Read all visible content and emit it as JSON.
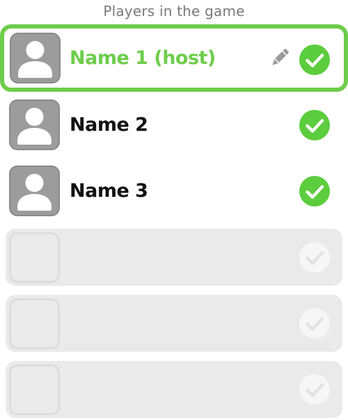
{
  "header": {
    "title": "Players in the game"
  },
  "players": [
    {
      "name": "Name 1 (host)",
      "is_host": true,
      "ready": true
    },
    {
      "name": "Name 2",
      "is_host": false,
      "ready": true
    },
    {
      "name": "Name 3",
      "is_host": false,
      "ready": true
    }
  ],
  "empty_slots": 3,
  "colors": {
    "accent": "#6dcd4a",
    "check_fill": "#5ccd3e",
    "avatar_bg": "#9c9c9c",
    "empty_row_bg": "#eaeaea",
    "header_text": "#7a7a7a"
  },
  "icons": {
    "avatar": "person-silhouette-icon",
    "ready": "check-circle-icon",
    "edit": "pencil-icon"
  }
}
